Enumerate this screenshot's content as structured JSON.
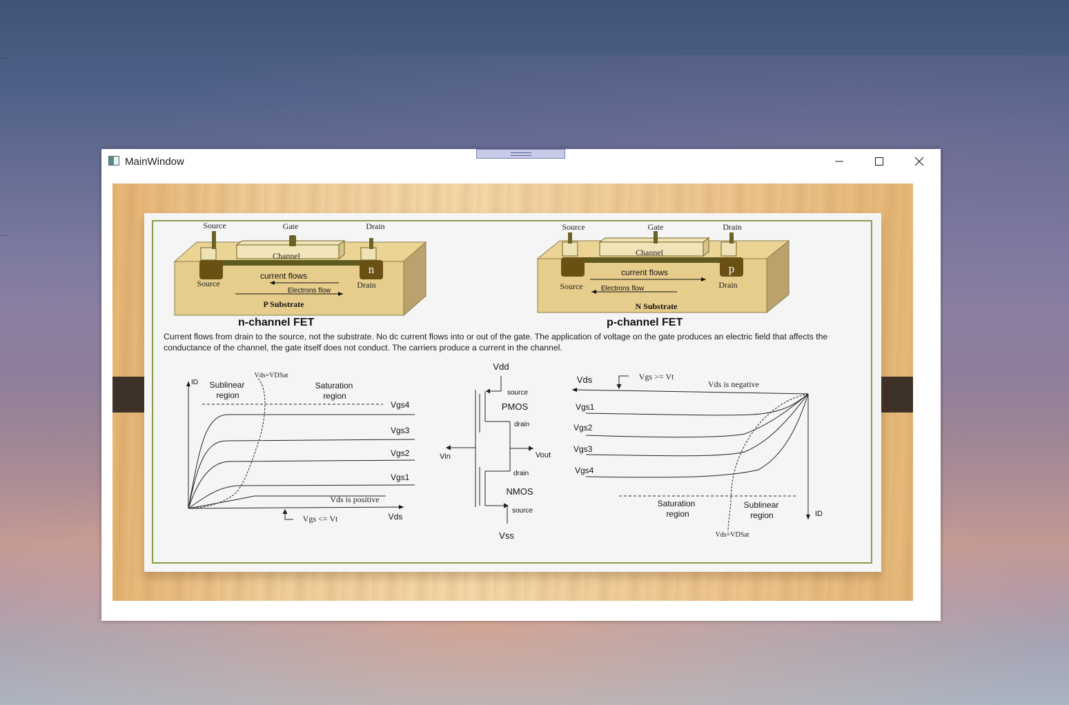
{
  "window": {
    "title": "MainWindow",
    "controls": {
      "minimize": "minimize-icon",
      "maximize": "maximize-icon",
      "close": "close-icon"
    }
  },
  "nfet": {
    "caption": "n-channel FET",
    "source": "Source",
    "gate": "Gate",
    "drain": "Drain",
    "channel": "Channel",
    "terminal": "n",
    "source_inner": "Source",
    "drain_inner": "Drain",
    "current": "current flows",
    "electrons": "Electrons flow",
    "substrate": "P Substrate"
  },
  "pfet": {
    "caption": "p-channel FET",
    "source": "Source",
    "gate": "Gate",
    "drain": "Drain",
    "channel": "Channel",
    "terminal": "p",
    "source_inner": "Source",
    "drain_inner": "Drain",
    "current": "current flows",
    "electrons": "Electrons flow",
    "substrate": "N Substrate"
  },
  "description": "Current flows from drain to the source, not the substrate. No dc current flows into or out of the gate. The application of voltage on the gate produces an electric field that affects the conductance of the channel, the gate itself does not conduct.  The carriers produce a current in the channel.",
  "ncurve": {
    "id_label": "ID",
    "vdsat": "Vds=VDSat",
    "sublinear": [
      "Sublinear",
      "region"
    ],
    "saturation": [
      "Saturation",
      "region"
    ],
    "vgs_labels": [
      "Vgs4",
      "Vgs3",
      "Vgs2",
      "Vgs1"
    ],
    "vds_positive": "Vds is positive",
    "vgs_cond": "Vgs <= Vt",
    "vds": "Vds"
  },
  "cmos": {
    "vdd": "Vdd",
    "source_top": "source",
    "pmos": "PMOS",
    "drain_top": "drain",
    "vin": "Vin",
    "vout": "Vout",
    "drain_bottom": "drain",
    "nmos": "NMOS",
    "source_bottom": "source",
    "vss": "Vss"
  },
  "pcurve": {
    "vds": "Vds",
    "vgs_cond": "Vgs >= Vt",
    "vds_negative": "Vds is negative",
    "vgs_labels": [
      "Vgs1",
      "Vgs2",
      "Vgs3",
      "Vgs4"
    ],
    "saturation": [
      "Saturation",
      "region"
    ],
    "sublinear": [
      "Sublinear",
      "region"
    ],
    "id_label": "ID",
    "vdsat": "Vds=VDSat"
  }
}
